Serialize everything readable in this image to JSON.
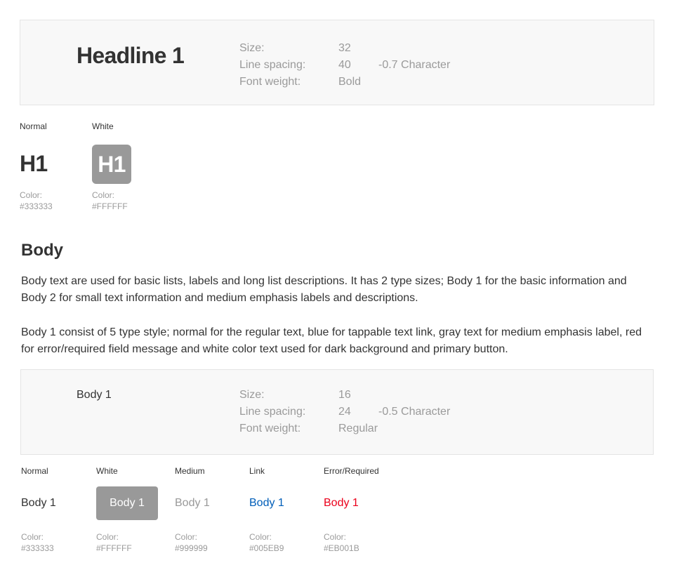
{
  "headline_spec": {
    "title": "Headline 1",
    "size_label": "Size:",
    "size_value": "32",
    "line_spacing_label": "Line spacing:",
    "line_spacing_value": "40",
    "character_spacing": "-0.7 Character",
    "font_weight_label": "Font weight:",
    "font_weight_value": "Bold"
  },
  "headline_variants": {
    "normal_label": "Normal",
    "white_label": "White",
    "sample_text": "H1",
    "normal_color": "Color:\n#333333",
    "white_color": "Color:\n#FFFFFF"
  },
  "body_section": {
    "title": "Body",
    "paragraph1": "Body text are used for basic lists, labels and long list descriptions. It has 2 type sizes; Body 1 for the basic information and Body 2 for small text information and medium emphasis labels and descriptions.",
    "paragraph2": "Body 1 consist of 5 type style; normal for the regular text, blue for tappable text link, gray text for medium emphasis label, red for error/required field message and white color text used for dark background and primary button."
  },
  "body_spec": {
    "title": "Body 1",
    "size_label": "Size:",
    "size_value": "16",
    "line_spacing_label": "Line spacing:",
    "line_spacing_value": "24",
    "character_spacing": "-0.5 Character",
    "font_weight_label": "Font weight:",
    "font_weight_value": "Regular"
  },
  "body_variants": {
    "sample_text": "Body 1",
    "normal_label": "Normal",
    "white_label": "White",
    "medium_label": "Medium",
    "link_label": "Link",
    "error_label": "Error/Required",
    "normal_color": "Color:\n#333333",
    "white_color": "Color:\n#FFFFFF",
    "medium_color": "Color:\n#999999",
    "link_color": "Color:\n#005EB9",
    "error_color": "Color:\n#EB001B"
  },
  "colors": {
    "normal": "#333333",
    "white": "#FFFFFF",
    "medium": "#999999",
    "link": "#005EB9",
    "error": "#EB001B"
  }
}
